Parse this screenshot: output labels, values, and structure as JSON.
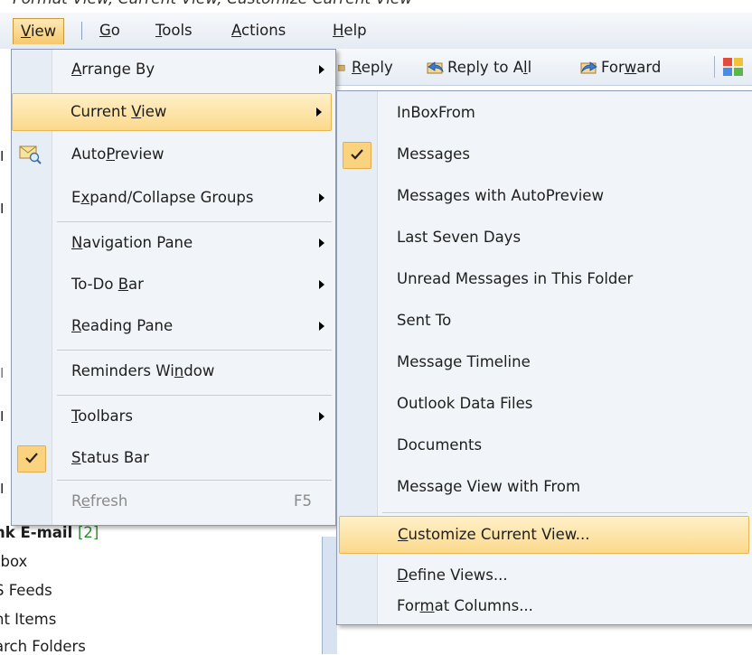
{
  "breadcrumb_fragment": "Format View, Current View, Customize Current View",
  "menubar": {
    "items": [
      {
        "label": "View",
        "ul": "V"
      },
      {
        "label": "Go",
        "ul": "G"
      },
      {
        "label": "Tools",
        "ul": "T"
      },
      {
        "label": "Actions",
        "ul": "A"
      },
      {
        "label": "Help",
        "ul": "H"
      }
    ]
  },
  "toolbar": {
    "reply": {
      "label": "Reply",
      "ul": "R"
    },
    "reply_all": {
      "label": "Reply to All",
      "ul": "l"
    },
    "forward": {
      "label": "Forward",
      "ul": "w"
    }
  },
  "nav": {
    "junk_label": "nk E-mail",
    "junk_count": "[2]",
    "outbox": "tbox",
    "rss": "S Feeds",
    "sent": "nt Items",
    "search": "arch Folders"
  },
  "view_menu": {
    "arrange_by": "Arrange By",
    "current_view": "Current View",
    "autopreview": "AutoPreview",
    "expand_collapse": "Expand/Collapse Groups",
    "navigation_pane": "Navigation Pane",
    "todo_bar": "To-Do Bar",
    "reading_pane": "Reading Pane",
    "reminders_window": "Reminders Window",
    "toolbars": "Toolbars",
    "status_bar": "Status Bar",
    "refresh": "Refresh",
    "refresh_shortcut": "F5"
  },
  "current_view_menu": {
    "items": [
      "InBoxFrom",
      "Messages",
      "Messages with AutoPreview",
      "Last Seven Days",
      "Unread Messages in This Folder",
      "Sent To",
      "Message Timeline",
      "Outlook Data Files",
      "Documents",
      "Message View with From",
      "Customize Current View...",
      "Define Views...",
      "Format Columns..."
    ],
    "checked": "Messages",
    "highlighted": "Customize Current View..."
  },
  "colors": {
    "highlight": "#fbd98c",
    "checkmark_bg": "#fbd37e",
    "menu_bg": "#f1f4f8",
    "junk_count": "#2e8b2e"
  },
  "icons": [
    "autopreview-icon",
    "reply-icon",
    "reply-all-icon",
    "forward-icon",
    "categorize-icon",
    "checkmark-icon",
    "submenu-arrow-icon"
  ]
}
